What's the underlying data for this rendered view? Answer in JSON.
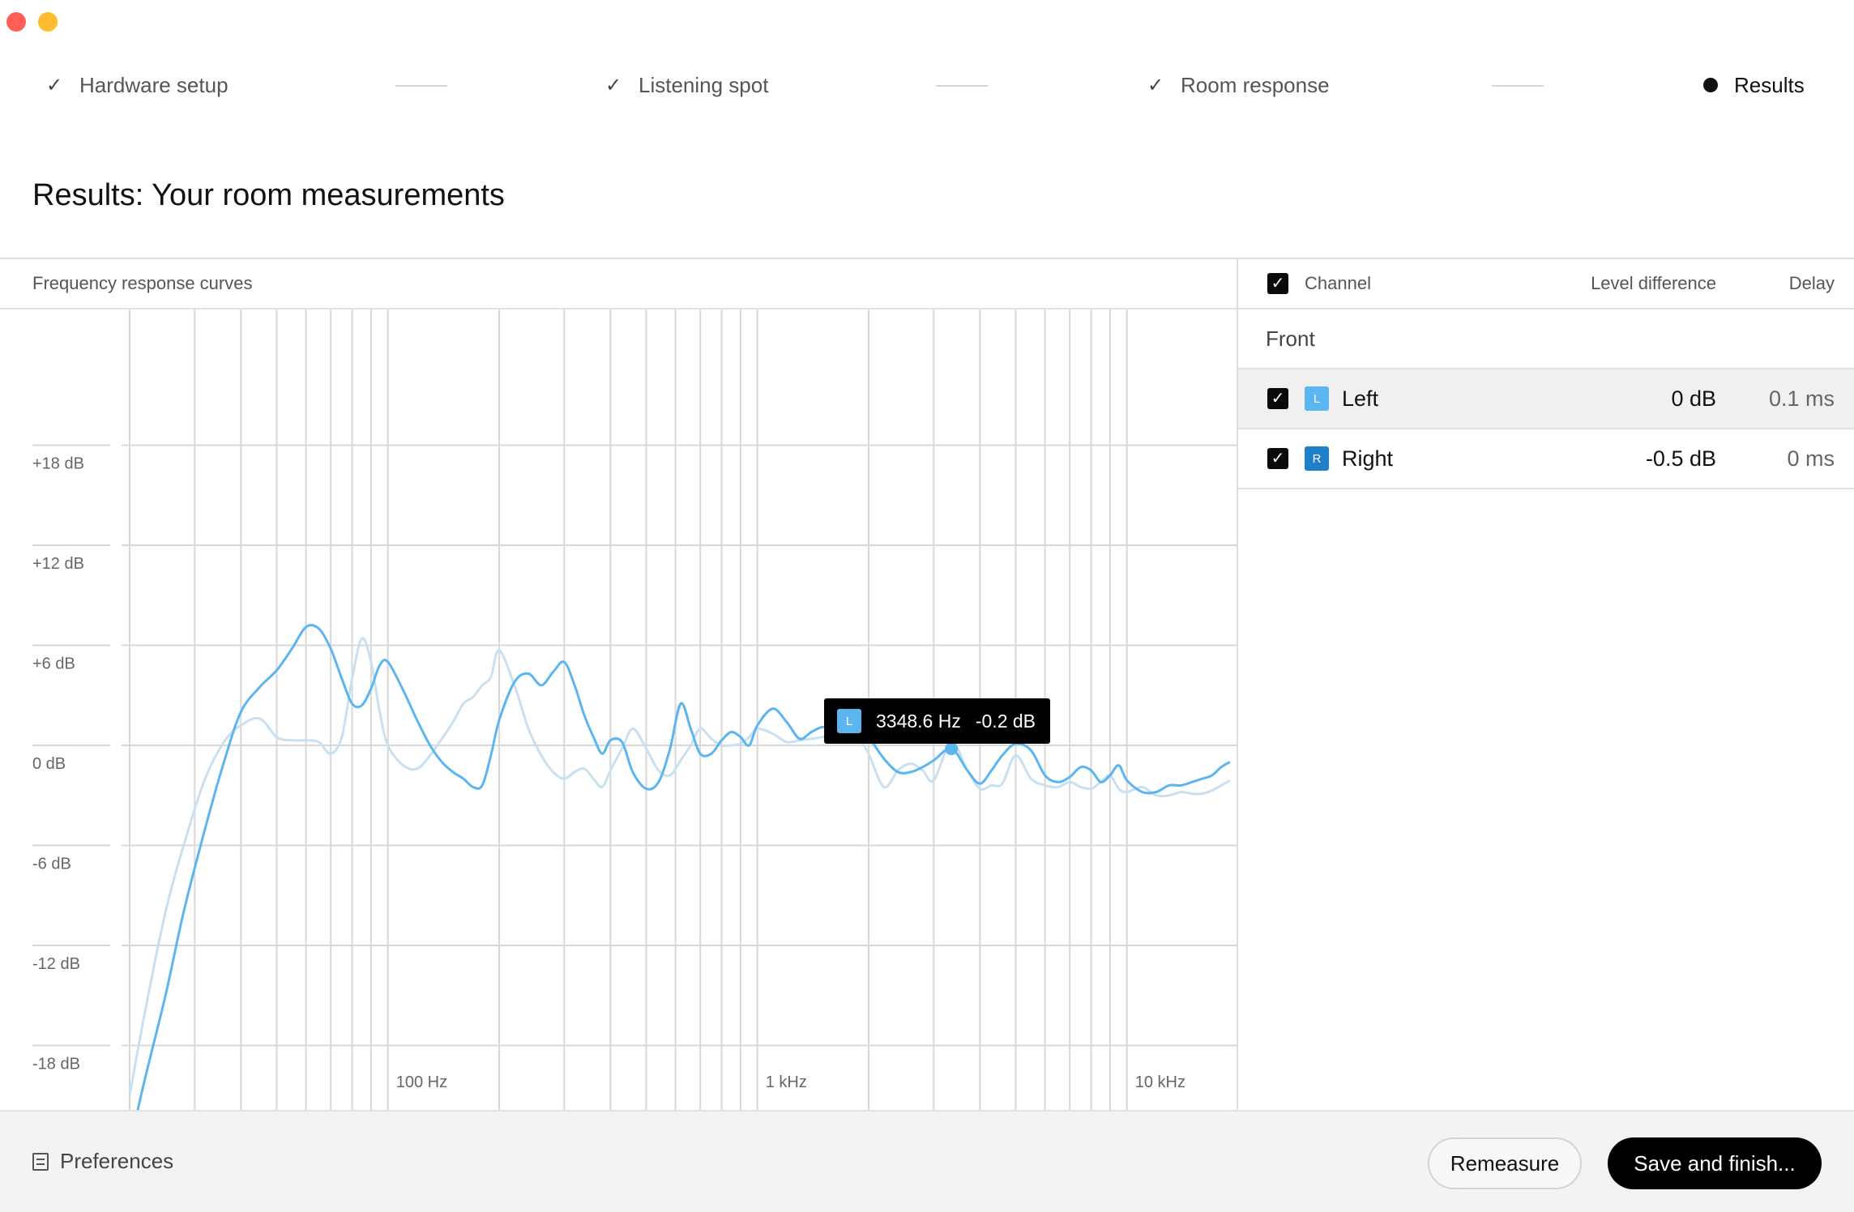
{
  "steps": [
    {
      "label": "Hardware setup",
      "state": "done"
    },
    {
      "label": "Listening spot",
      "state": "done"
    },
    {
      "label": "Room response",
      "state": "done"
    },
    {
      "label": "Results",
      "state": "current"
    }
  ],
  "page_title": "Results: Your room measurements",
  "chart_panel": {
    "title": "Frequency response curves"
  },
  "tooltip": {
    "channel_badge": "L",
    "frequency": "3348.6 Hz",
    "level": "-0.2 dB"
  },
  "channels_panel": {
    "headers": {
      "channel": "Channel",
      "level_difference": "Level difference",
      "delay": "Delay"
    },
    "group": "Front",
    "rows": [
      {
        "badge": "L",
        "name": "Left",
        "level": "0 dB",
        "delay": "0.1 ms",
        "badge_color": "#5bb6ef",
        "selected": true
      },
      {
        "badge": "R",
        "name": "Right",
        "level": "-0.5 dB",
        "delay": "0 ms",
        "badge_color": "#1f7fc9",
        "selected": false
      }
    ]
  },
  "footer": {
    "preferences": "Preferences",
    "remeasure": "Remeasure",
    "save": "Save and finish..."
  },
  "colors": {
    "left_curve": "#5bb6ef",
    "right_curve": "#c9e0f0",
    "grid": "#d8d8d8"
  },
  "chart_data": {
    "type": "line",
    "x_scale": "log",
    "x_unit": "Hz",
    "xlim": [
      20,
      20000
    ],
    "ylim": [
      -24,
      24
    ],
    "y_ticks": [
      18,
      12,
      6,
      0,
      -6,
      -12,
      -18
    ],
    "y_tick_labels": [
      "+18 dB",
      "+12 dB",
      "+6 dB",
      "0 dB",
      "-6 dB",
      "-12 dB",
      "-18 dB"
    ],
    "x_ticks": [
      100,
      1000,
      10000
    ],
    "x_tick_labels": [
      "100 Hz",
      "1 kHz",
      "10 kHz"
    ],
    "grid": true,
    "highlight_point": {
      "x": 3348.6,
      "y": -0.2
    },
    "series": [
      {
        "id": "left",
        "x": [
          20,
          22,
          25,
          28,
          32,
          36,
          40,
          45,
          50,
          55,
          60,
          65,
          70,
          75,
          80,
          85,
          90,
          95,
          100,
          110,
          120,
          130,
          140,
          150,
          160,
          170,
          180,
          190,
          200,
          220,
          240,
          260,
          280,
          300,
          320,
          340,
          360,
          380,
          400,
          430,
          460,
          500,
          540,
          580,
          620,
          660,
          700,
          750,
          800,
          850,
          900,
          950,
          1000,
          1100,
          1200,
          1300,
          1400,
          1500,
          1600,
          1700,
          1800,
          1900,
          2000,
          2200,
          2400,
          2600,
          2800,
          3000,
          3348.6,
          3700,
          4000,
          4300,
          4600,
          5000,
          5500,
          6000,
          6500,
          7000,
          7500,
          8000,
          8500,
          9000,
          9500,
          10000,
          11000,
          12000,
          13000,
          14000,
          15000,
          16000,
          17000,
          18000,
          19000,
          20000
        ],
        "y": [
          -24,
          -20,
          -15,
          -10,
          -5,
          -1,
          2,
          3.5,
          4.5,
          5.8,
          7.1,
          7.0,
          5.8,
          4.0,
          2.5,
          2.4,
          3.4,
          4.8,
          5.0,
          3.3,
          1.5,
          0.0,
          -1.0,
          -1.6,
          -2.0,
          -2.5,
          -2.4,
          -0.6,
          1.5,
          3.8,
          4.3,
          3.6,
          4.4,
          5.0,
          3.6,
          1.8,
          0.5,
          -0.5,
          0.3,
          0.2,
          -1.6,
          -2.6,
          -2.2,
          -0.2,
          2.5,
          1.0,
          -0.5,
          -0.5,
          0.3,
          0.8,
          0.5,
          0.0,
          1.2,
          2.2,
          1.4,
          0.4,
          0.8,
          1.1,
          1.0,
          1.2,
          1.3,
          0.9,
          0.5,
          -0.8,
          -1.6,
          -1.6,
          -1.3,
          -0.9,
          -0.2,
          -1.5,
          -2.3,
          -1.5,
          -0.6,
          0.1,
          -0.3,
          -1.8,
          -2.2,
          -1.9,
          -1.3,
          -1.5,
          -2.2,
          -1.8,
          -1.2,
          -2.1,
          -2.8,
          -2.8,
          -2.4,
          -2.4,
          -2.2,
          -2.0,
          -1.8,
          -1.3,
          -1.0,
          -0.8
        ]
      },
      {
        "id": "right",
        "x": [
          20,
          22,
          25,
          28,
          32,
          36,
          40,
          45,
          50,
          55,
          60,
          65,
          70,
          75,
          80,
          85,
          90,
          95,
          100,
          110,
          120,
          130,
          140,
          150,
          160,
          170,
          180,
          190,
          200,
          220,
          240,
          260,
          280,
          300,
          320,
          340,
          360,
          380,
          400,
          430,
          460,
          500,
          540,
          580,
          620,
          660,
          700,
          750,
          800,
          850,
          900,
          950,
          1000,
          1100,
          1200,
          1300,
          1400,
          1500,
          1600,
          1700,
          1800,
          1900,
          2000,
          2200,
          2400,
          2600,
          2800,
          3000,
          3348.6,
          3700,
          4000,
          4300,
          4600,
          5000,
          5500,
          6000,
          6500,
          7000,
          7500,
          8000,
          8500,
          9000,
          9500,
          10000,
          11000,
          12000,
          13000,
          14000,
          15000,
          16000,
          17000,
          18000,
          19000,
          20000
        ],
        "y": [
          -21,
          -16,
          -10,
          -6,
          -2,
          0.2,
          1.2,
          1.6,
          0.5,
          0.3,
          0.3,
          0.2,
          -0.5,
          0.5,
          4.0,
          6.4,
          5.0,
          2.0,
          0.0,
          -1.2,
          -1.4,
          -0.6,
          0.4,
          1.4,
          2.5,
          2.9,
          3.6,
          4.1,
          5.7,
          3.6,
          1.0,
          -0.6,
          -1.6,
          -2.0,
          -1.6,
          -1.4,
          -2.0,
          -2.5,
          -1.5,
          -0.2,
          1.0,
          -0.2,
          -1.5,
          -1.8,
          -0.9,
          0.0,
          1.0,
          0.4,
          0.0,
          0.0,
          0.1,
          0.5,
          1.0,
          0.7,
          0.2,
          0.3,
          0.4,
          0.5,
          0.7,
          0.8,
          0.9,
          0.3,
          -0.5,
          -2.5,
          -1.5,
          -1.1,
          -1.5,
          -2.1,
          0.2,
          -1.5,
          -2.6,
          -2.4,
          -2.3,
          -0.6,
          -2.0,
          -2.4,
          -2.5,
          -2.2,
          -2.5,
          -2.6,
          -2.2,
          -1.8,
          -2.6,
          -2.8,
          -2.5,
          -3.0,
          -3.0,
          -2.8,
          -2.9,
          -2.9,
          -2.7,
          -2.4,
          -2.1,
          -1.8
        ]
      }
    ]
  }
}
